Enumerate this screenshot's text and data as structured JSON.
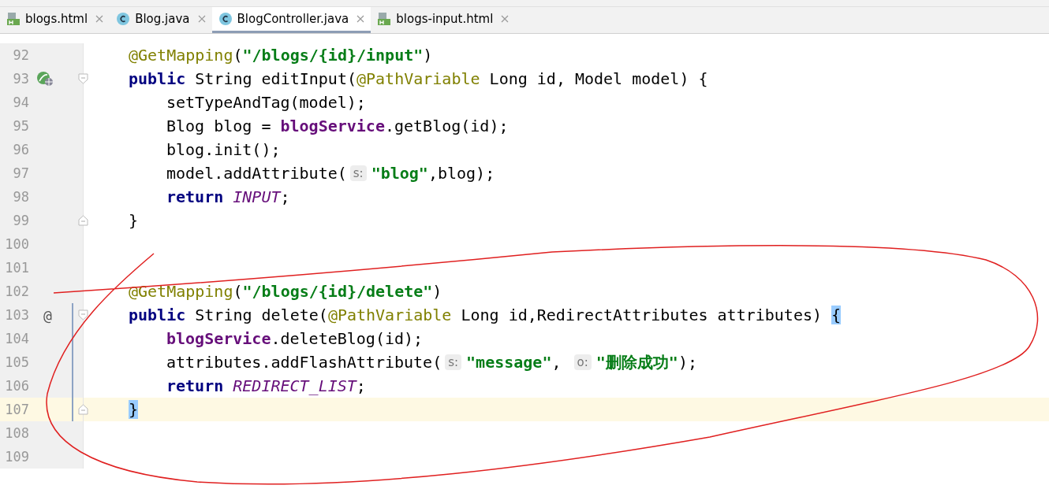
{
  "tabs": [
    {
      "label": "blogs.html",
      "kind": "html",
      "selected": false
    },
    {
      "label": "Blog.java",
      "kind": "class",
      "selected": false
    },
    {
      "label": "BlogController.java",
      "kind": "class",
      "selected": true
    },
    {
      "label": "blogs-input.html",
      "kind": "html",
      "selected": false
    }
  ],
  "editor": {
    "lines": [
      {
        "number": "92",
        "current": false,
        "changed": false,
        "indented": false,
        "tokens": [
          {
            "kind": "annotation",
            "text": "@GetMapping"
          },
          {
            "kind": "plain",
            "text": "("
          },
          {
            "kind": "string",
            "text": "\"/blogs/{id}/input\""
          },
          {
            "kind": "plain",
            "text": ")"
          }
        ]
      },
      {
        "number": "93",
        "current": false,
        "changed": false,
        "indented": false,
        "gutter": {
          "kind": "bean"
        },
        "fold_open": true,
        "tokens": [
          {
            "kind": "keyword",
            "text": "public"
          },
          {
            "kind": "plain",
            "text": " String editInput("
          },
          {
            "kind": "annotation",
            "text": "@PathVariable"
          },
          {
            "kind": "plain",
            "text": " Long id, Model model) {"
          }
        ]
      },
      {
        "number": "94",
        "current": false,
        "changed": false,
        "indented": true,
        "tokens": [
          {
            "kind": "plain",
            "text": "setTypeAndTag(model);"
          }
        ]
      },
      {
        "number": "95",
        "current": false,
        "changed": false,
        "indented": true,
        "tokens": [
          {
            "kind": "plain",
            "text": "Blog blog = "
          },
          {
            "kind": "field",
            "text": "blogService"
          },
          {
            "kind": "plain",
            "text": ".getBlog(id);"
          }
        ]
      },
      {
        "number": "96",
        "current": false,
        "changed": false,
        "indented": true,
        "tokens": [
          {
            "kind": "plain",
            "text": "blog.init();"
          }
        ]
      },
      {
        "number": "97",
        "current": false,
        "changed": false,
        "indented": true,
        "tokens": [
          {
            "kind": "plain",
            "text": "model.addAttribute("
          },
          {
            "kind": "hint",
            "text": "s:"
          },
          {
            "kind": "string",
            "text": "\"blog\""
          },
          {
            "kind": "plain",
            "text": ",blog);"
          }
        ]
      },
      {
        "number": "98",
        "current": false,
        "changed": false,
        "indented": true,
        "tokens": [
          {
            "kind": "keyword",
            "text": "return"
          },
          {
            "kind": "constant",
            "text": " INPUT"
          },
          {
            "kind": "plain",
            "text": ";"
          }
        ]
      },
      {
        "number": "99",
        "current": false,
        "changed": false,
        "indented": false,
        "fold_close": true,
        "tokens": [
          {
            "kind": "plain",
            "text": "}"
          }
        ]
      },
      {
        "number": "100",
        "current": false,
        "changed": false
      },
      {
        "number": "101",
        "current": false,
        "changed": false
      },
      {
        "number": "102",
        "current": false,
        "changed": false,
        "indented": false,
        "tokens": [
          {
            "kind": "annotation",
            "text": "@GetMapping"
          },
          {
            "kind": "plain",
            "text": "("
          },
          {
            "kind": "string",
            "text": "\"/blogs/{id}/delete\""
          },
          {
            "kind": "plain",
            "text": ")"
          }
        ]
      },
      {
        "number": "103",
        "current": false,
        "changed": true,
        "indented": false,
        "gutter": {
          "kind": "text",
          "text": "@"
        },
        "fold_open": true,
        "tokens": [
          {
            "kind": "keyword",
            "text": "public"
          },
          {
            "kind": "plain",
            "text": " String delete("
          },
          {
            "kind": "annotation",
            "text": "@PathVariable"
          },
          {
            "kind": "plain",
            "text": " Long id,RedirectAttributes attributes) "
          },
          {
            "kind": "brace",
            "text": "{"
          }
        ]
      },
      {
        "number": "104",
        "current": false,
        "changed": true,
        "indented": true,
        "tokens": [
          {
            "kind": "field",
            "text": "blogService"
          },
          {
            "kind": "plain",
            "text": ".deleteBlog(id);"
          }
        ]
      },
      {
        "number": "105",
        "current": false,
        "changed": true,
        "indented": true,
        "tokens": [
          {
            "kind": "plain",
            "text": "attributes.addFlashAttribute("
          },
          {
            "kind": "hint",
            "text": "s:"
          },
          {
            "kind": "string",
            "text": "\"message\""
          },
          {
            "kind": "plain",
            "text": ", "
          },
          {
            "kind": "hint",
            "text": "o:"
          },
          {
            "kind": "string",
            "text": "\"删除成功\""
          },
          {
            "kind": "plain",
            "text": ");"
          }
        ]
      },
      {
        "number": "106",
        "current": false,
        "changed": true,
        "indented": true,
        "tokens": [
          {
            "kind": "keyword",
            "text": "return"
          },
          {
            "kind": "constant",
            "text": " REDIRECT_LIST"
          },
          {
            "kind": "plain",
            "text": ";"
          }
        ]
      },
      {
        "number": "107",
        "current": true,
        "changed": true,
        "indented": false,
        "fold_close": true,
        "tokens": [
          {
            "kind": "brace",
            "text": "}"
          }
        ]
      },
      {
        "number": "108",
        "current": false,
        "changed": false
      },
      {
        "number": "109",
        "current": false,
        "changed": false
      }
    ]
  }
}
